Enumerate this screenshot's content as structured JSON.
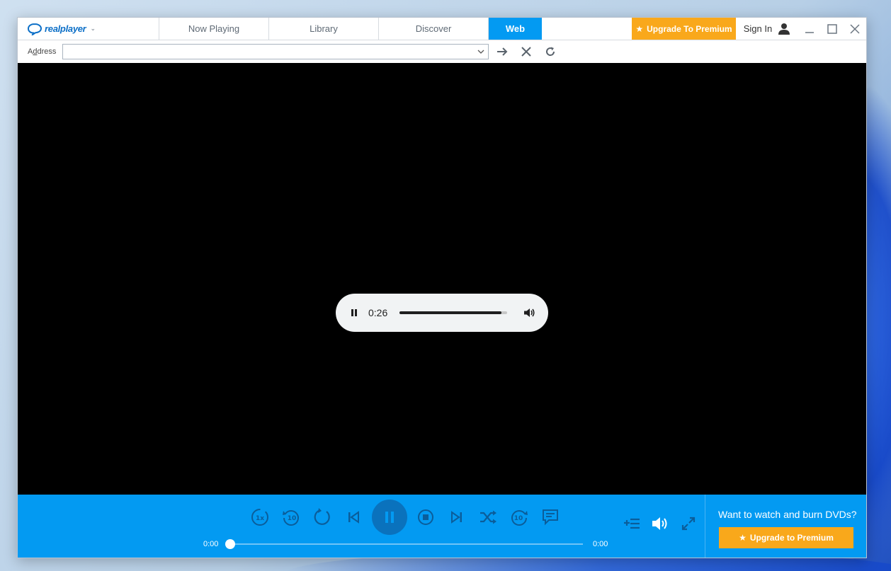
{
  "app": {
    "logo_text": "realplayer"
  },
  "tabs": [
    {
      "label": "Now Playing"
    },
    {
      "label": "Library"
    },
    {
      "label": "Discover"
    },
    {
      "label": "Web"
    }
  ],
  "header": {
    "premium_label": "Upgrade To Premium",
    "signin_label": "Sign In"
  },
  "address": {
    "label_prefix": "A",
    "label_underlined": "d",
    "label_suffix": "dress",
    "value": "",
    "placeholder": ""
  },
  "audio": {
    "time": "0:26",
    "progress_fraction": 0.95
  },
  "player": {
    "elapsed": "0:00",
    "duration": "0:00",
    "seek_fraction": 0.0
  },
  "promo": {
    "text": "Want to watch and burn DVDs?",
    "button_label": "Upgrade to Premium"
  },
  "colors": {
    "accent": "#039af2",
    "premium": "#f9a81b",
    "play_button": "#0a72bd"
  },
  "icons": {
    "logo": "realplayer-logo-icon",
    "star": "star-icon",
    "user": "user-icon"
  }
}
